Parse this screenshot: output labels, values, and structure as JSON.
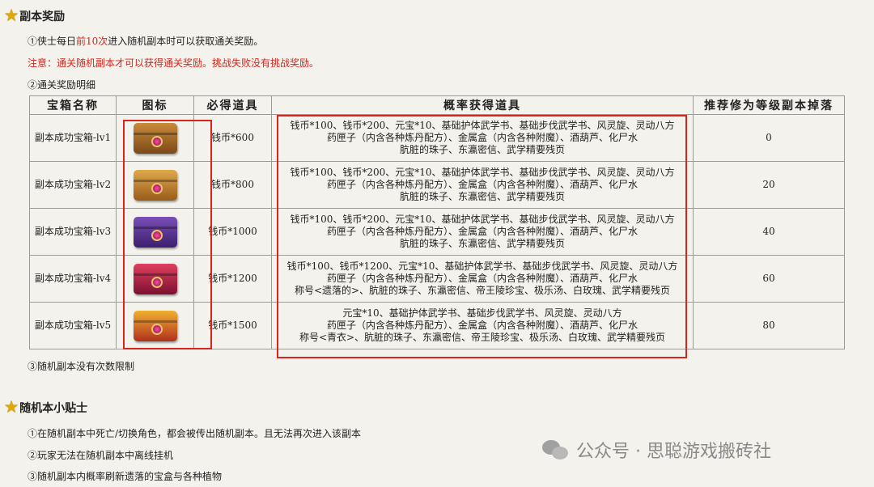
{
  "section1": {
    "title": "副本奖励",
    "line1_prefix": "①侠士每日",
    "line1_highlight": "前10次",
    "line1_suffix": "进入随机副本时可以获取通关奖励。",
    "note": "注意：通关随机副本才可以获得通关奖励。挑战失败没有挑战奖励。",
    "line2": "②通关奖励明细",
    "line3": "③随机副本没有次数限制"
  },
  "table": {
    "headers": [
      "宝箱名称",
      "图标",
      "必得道具",
      "概率获得道具",
      "推荐修为等级副本掉落"
    ],
    "rows": [
      {
        "name": "副本成功宝箱-lv1",
        "icon": "chest-lv1-icon",
        "guaranteed": "钱币*600",
        "probable": [
          "钱币*100、钱币*200、元宝*10、基础护体武学书、基础步伐武学书、风灵旋、灵动八方",
          "药匣子（内含各种炼丹配方）、金属盒（内含各种附魔）、酒葫芦、化尸水",
          "肮脏的珠子、东瀛密信、武学精要残页"
        ],
        "level": "0"
      },
      {
        "name": "副本成功宝箱-lv2",
        "icon": "chest-lv2-icon",
        "guaranteed": "钱币*800",
        "probable": [
          "钱币*100、钱币*200、元宝*10、基础护体武学书、基础步伐武学书、风灵旋、灵动八方",
          "药匣子（内含各种炼丹配方）、金属盒（内含各种附魔）、酒葫芦、化尸水",
          "肮脏的珠子、东瀛密信、武学精要残页"
        ],
        "level": "20"
      },
      {
        "name": "副本成功宝箱-lv3",
        "icon": "chest-lv3-icon",
        "guaranteed": "钱币*1000",
        "probable": [
          "钱币*100、钱币*200、元宝*10、基础护体武学书、基础步伐武学书、风灵旋、灵动八方",
          "药匣子（内含各种炼丹配方）、金属盒（内含各种附魔）、酒葫芦、化尸水",
          "肮脏的珠子、东瀛密信、武学精要残页"
        ],
        "level": "40"
      },
      {
        "name": "副本成功宝箱-lv4",
        "icon": "chest-lv4-icon",
        "guaranteed": "钱币*1200",
        "probable": [
          "钱币*100、钱币*1200、元宝*10、基础护体武学书、基础步伐武学书、风灵旋、灵动八方",
          "药匣子（内含各种炼丹配方）、金属盒（内含各种附魔）、酒葫芦、化尸水",
          "称号<遗落的>、肮脏的珠子、东瀛密信、帝王陵珍宝、极乐汤、白玫瑰、武学精要残页"
        ],
        "level": "60"
      },
      {
        "name": "副本成功宝箱-lv5",
        "icon": "chest-lv5-icon",
        "guaranteed": "钱币*1500",
        "probable": [
          "元宝*10、基础护体武学书、基础步伐武学书、风灵旋、灵动八方",
          "药匣子（内含各种炼丹配方）、金属盒（内含各种附魔）、酒葫芦、化尸水",
          "称号<青衣>、肮脏的珠子、东瀛密信、帝王陵珍宝、极乐汤、白玫瑰、武学精要残页"
        ],
        "level": "80"
      }
    ]
  },
  "section2": {
    "title": "随机本小贴士",
    "tips": [
      "①在随机副本中死亡/切换角色，都会被传出随机副本。且无法再次进入该副本",
      "②玩家无法在随机副本中离线挂机",
      "③随机副本内概率刷新遗落的宝盒与各种植物"
    ]
  },
  "watermark": {
    "text": "公众号 · 思聪游戏搬砖社",
    "icon": "wechat-icon"
  },
  "colors": {
    "highlight_red": "#d8241c",
    "star": "#e0a800",
    "background": "#f4f2ec"
  }
}
